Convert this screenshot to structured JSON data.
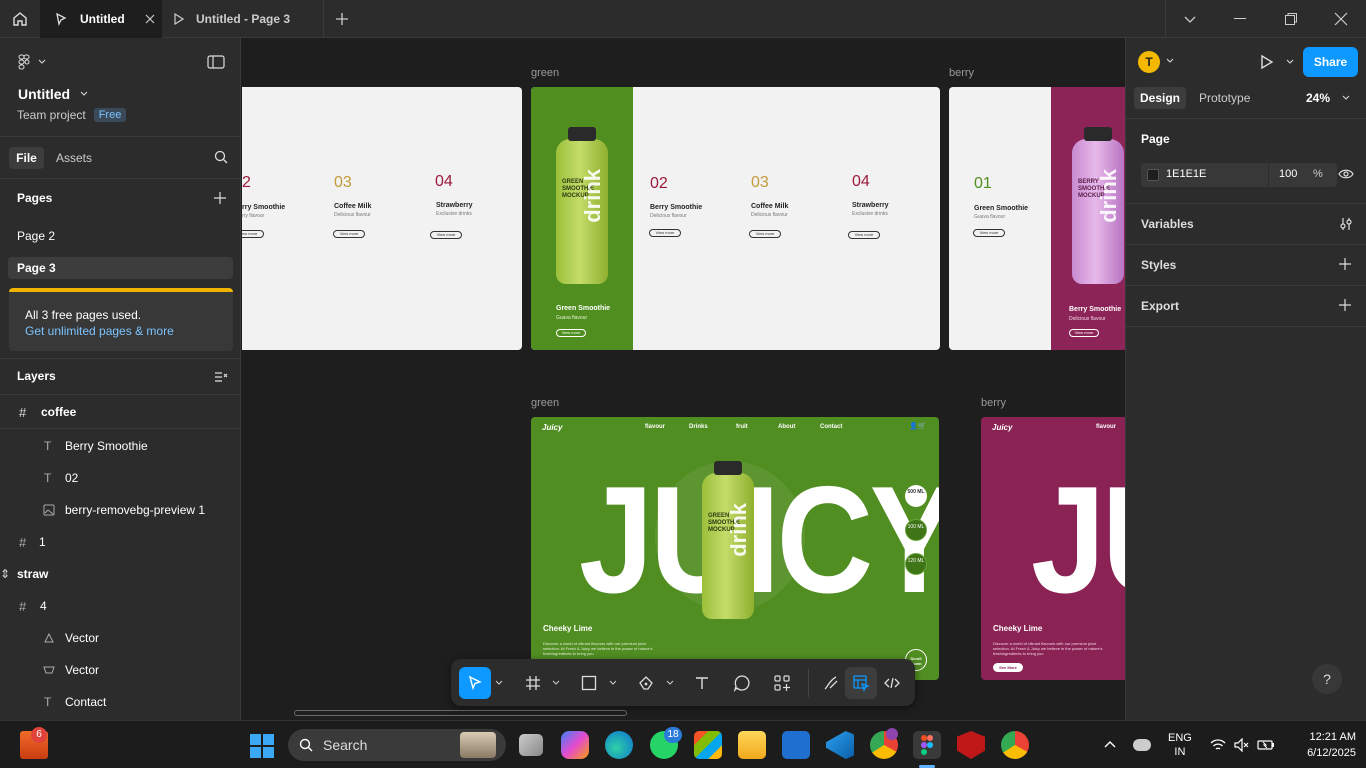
{
  "titlebar": {
    "tabs": [
      {
        "label": "Untitled"
      },
      {
        "label": "Untitled - Page 3"
      }
    ]
  },
  "left": {
    "file_name": "Untitled",
    "team": "Team project",
    "plan_badge": "Free",
    "tab_file": "File",
    "tab_assets": "Assets",
    "pages_title": "Pages",
    "pages": [
      "Page 2",
      "Page 3"
    ],
    "notice_text": "All 3 free pages used.",
    "notice_link": "Get unlimited pages & more",
    "layers_title": "Layers",
    "layers": [
      {
        "label": "coffee",
        "icon": "frame-icon"
      },
      {
        "label": "Berry Smoothie",
        "icon": "text-icon"
      },
      {
        "label": "02",
        "icon": "text-icon"
      },
      {
        "label": "berry-removebg-preview 1",
        "icon": "image-icon"
      },
      {
        "label": "1",
        "icon": "frame-icon"
      },
      {
        "label": "straw",
        "icon": "move-icon"
      },
      {
        "label": "4",
        "icon": "frame-icon"
      },
      {
        "label": "Vector",
        "icon": "vector-icon"
      },
      {
        "label": "Vector",
        "icon": "vector-icon"
      },
      {
        "label": "Contact",
        "icon": "text-icon"
      }
    ]
  },
  "right": {
    "avatar": "T",
    "share": "Share",
    "tab_design": "Design",
    "tab_prototype": "Prototype",
    "zoom": "24%",
    "page_title": "Page",
    "bg_hex": "1E1E1E",
    "bg_opacity": "100",
    "pct": "%",
    "variables": "Variables",
    "styles": "Styles",
    "export": "Export",
    "help": "?"
  },
  "canvas": {
    "labels": {
      "green_top": "green",
      "berry_top": "berry",
      "green_bottom": "green",
      "berry_bottom": "berry"
    },
    "frame1": {
      "n2": "2",
      "n3": "03",
      "n4": "04",
      "p2": "rry Smoothie",
      "p2s": "rry flavour",
      "p3": "Coffee Milk",
      "p3s": "Delicious flavour",
      "p4": "Strawberry",
      "p4s": "Exclusive drinks",
      "btn": "View more"
    },
    "frame2": {
      "hero_name": "Green Smoothie",
      "hero_sub": "Guava flavour",
      "hero_btn": "View more",
      "n2": "02",
      "n3": "03",
      "n4": "04",
      "p2": "Berry Smoothie",
      "p2s": "Delicious flavour",
      "p3": "Coffee Milk",
      "p3s": "Delicious flavour",
      "p4": "Strawberry",
      "p4s": "Exclusive drinks",
      "btn": "View more"
    },
    "frame3": {
      "n1": "01",
      "p1": "Green Smoothie",
      "p1s": "Guava flavour",
      "btn": "View more",
      "hero_name": "Berry Smoothie",
      "hero_sub": "Delicious flavour",
      "hero_btn": "View more"
    },
    "bottle": {
      "brand": "drink",
      "mock": "GREEN SMOOTHIE MOCKUP",
      "mock_berry": "BERRY SMOOTHIE MOCKUP"
    },
    "frame4": {
      "logo": "Juicy",
      "nav": [
        "flavour",
        "Drinks",
        "fruit",
        "About",
        "Contact"
      ],
      "hero": "JUICY",
      "sizes": [
        "500 ML",
        "100 ML",
        "120 ML"
      ],
      "title": "Cheeky Lime",
      "desc": "Discover a world of vibrant flavours with our premium juice selection. At Fresh & Juicy we believe in the power of nature's freshingredients to bring you",
      "scroll": "Scroll Down"
    },
    "frame5": {
      "logo": "Juicy",
      "nav": "flavour",
      "hero": "JU",
      "title": "Cheeky Lime",
      "desc": "Discover a world of vibrant flavours with our premium juice selection. At Fresh & Juicy we believe in the power of nature's freshingredients to bring you",
      "btn": "See More"
    }
  },
  "taskbar": {
    "search": "Search",
    "badge_left": "6",
    "badge_whatsapp": "18",
    "lang": "ENG",
    "region": "IN",
    "time": "12:21 AM",
    "date": "6/12/2025"
  },
  "colors": {
    "accent": "#0d99ff",
    "green": "#508f1f",
    "berry": "#8c2457",
    "notice": "#f0b400"
  }
}
